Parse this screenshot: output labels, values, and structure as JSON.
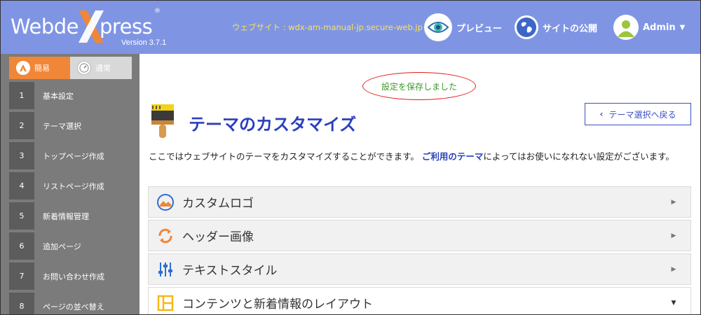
{
  "header": {
    "logo": "WebdeXpress",
    "logo_registered": "®",
    "version": "Version 3.7.1",
    "website_label": "ウェブサイト : wdx-am-manual-jp.secure-web.jp",
    "preview": "プレビュー",
    "publish": "サイトの公開",
    "admin": "Admin",
    "colors": {
      "bg": "#7f95e4",
      "site_label": "#f7e25b"
    }
  },
  "sidebar": {
    "mode_simple": "簡易",
    "mode_normal": "通常",
    "items": [
      {
        "num": "1",
        "label": "基本設定"
      },
      {
        "num": "2",
        "label": "テーマ選択"
      },
      {
        "num": "3",
        "label": "トップページ作成"
      },
      {
        "num": "4",
        "label": "リストページ作成"
      },
      {
        "num": "5",
        "label": "新着情報管理"
      },
      {
        "num": "6",
        "label": "追加ページ"
      },
      {
        "num": "7",
        "label": "お問い合わせ作成"
      },
      {
        "num": "8",
        "label": "ページの並べ替え"
      }
    ]
  },
  "main": {
    "saved_message": "設定を保存しました",
    "title": "テーマのカスタマイズ",
    "back_button": "テーマ選択へ戻る",
    "intro_before": "ここではウェブサイトのテーマをカスタマイズすることができます。",
    "intro_link": "ご利用のテーマ",
    "intro_after": "によってはお使いになれない設定がございます。",
    "sections": [
      {
        "label": "カスタムロゴ",
        "icon": "image-icon",
        "state": "collapsed"
      },
      {
        "label": "ヘッダー画像",
        "icon": "refresh-icon",
        "state": "collapsed"
      },
      {
        "label": "テキストスタイル",
        "icon": "sliders-icon",
        "state": "collapsed"
      },
      {
        "label": "コンテンツと新着情報のレイアウト",
        "icon": "layout-icon",
        "state": "expanded"
      }
    ]
  }
}
